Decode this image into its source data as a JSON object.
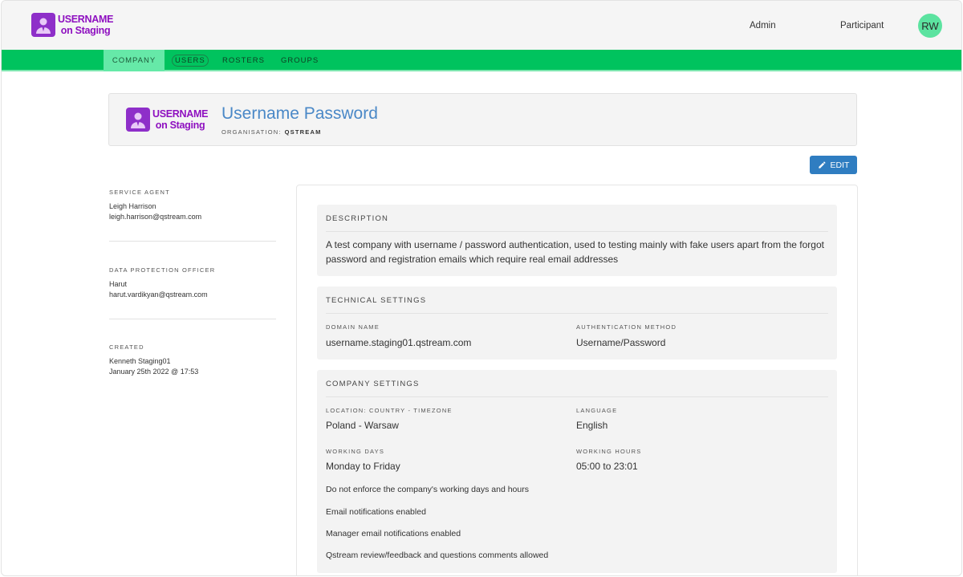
{
  "header": {
    "logo_line1": "USERNAME",
    "logo_line2": "on Staging",
    "nav_admin": "Admin",
    "nav_participant": "Participant",
    "avatar_initials": "RW"
  },
  "tabs": [
    {
      "label": "COMPANY",
      "active": true
    },
    {
      "label": "USERS",
      "active": false
    },
    {
      "label": "ROSTERS",
      "active": false
    },
    {
      "label": "GROUPS",
      "active": false
    }
  ],
  "company": {
    "logo_line1": "USERNAME",
    "logo_line2": "on Staging",
    "title": "Username Password",
    "org_label": "ORGANISATION:",
    "org_value": "QSTREAM"
  },
  "actions": {
    "edit_label": "EDIT"
  },
  "sidebar": {
    "service_agent": {
      "label": "SERVICE AGENT",
      "name": "Leigh Harrison",
      "email": "leigh.harrison@qstream.com"
    },
    "dpo": {
      "label": "DATA PROTECTION OFFICER",
      "name": "Harut",
      "email": "harut.vardikyan@qstream.com"
    },
    "created": {
      "label": "CREATED",
      "name": "Kenneth Staging01",
      "date": "January 25th 2022 @ 17:53"
    }
  },
  "description": {
    "title": "DESCRIPTION",
    "text": "A test company with username / password authentication, used to testing mainly with fake users apart from the forgot password and registration emails which require real email addresses"
  },
  "technical": {
    "title": "TECHNICAL SETTINGS",
    "domain_label": "DOMAIN NAME",
    "domain_value": "username.staging01.qstream.com",
    "auth_label": "AUTHENTICATION METHOD",
    "auth_value": "Username/Password"
  },
  "company_settings": {
    "title": "COMPANY SETTINGS",
    "location_label": "LOCATION: COUNTRY - TIMEZONE",
    "location_value": "Poland - Warsaw",
    "language_label": "LANGUAGE",
    "language_value": "English",
    "days_label": "WORKING DAYS",
    "days_value": "Monday to Friday",
    "hours_label": "WORKING HOURS",
    "hours_value": "05:00 to 23:01",
    "flags": [
      "Do not enforce the company's working days and hours",
      "Email notifications enabled",
      "Manager email notifications enabled",
      "Qstream review/feedback and questions comments allowed"
    ]
  },
  "colors": {
    "accent_green": "#00c35e",
    "active_tab": "#66e9a8",
    "title_blue": "#4a88c7",
    "edit_button": "#2f7dc1",
    "logo_purple": "#8e2fc9"
  }
}
